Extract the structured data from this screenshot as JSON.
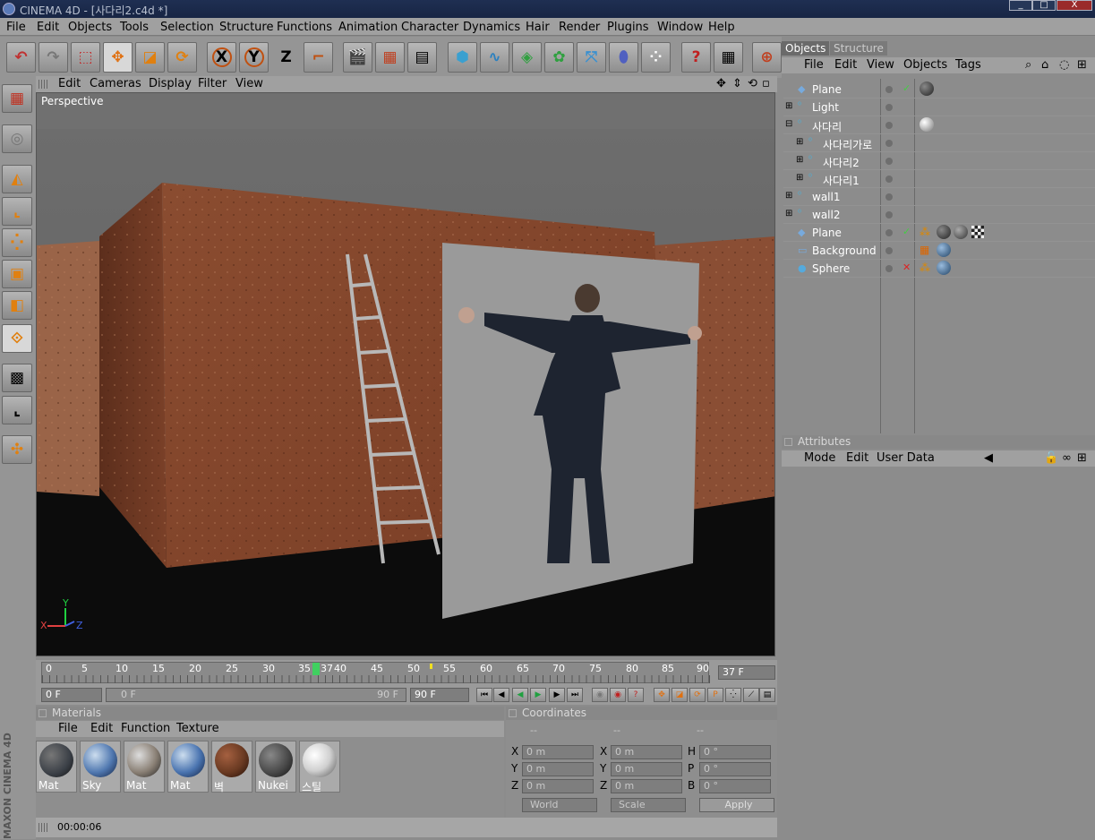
{
  "window": {
    "title": "CINEMA 4D - [사다리2.c4d *]",
    "minimize_label": "_",
    "maximize_label": "□",
    "close_label": "X"
  },
  "menu": [
    "File",
    "Edit",
    "Objects",
    "Tools",
    "Selection",
    "Structure",
    "Functions",
    "Animation",
    "Character",
    "Dynamics",
    "Hair",
    "Render",
    "Plugins",
    "Window",
    "Help"
  ],
  "toolbar": {
    "undo_icon": "undo-icon",
    "x_label": "X",
    "y_label": "Y",
    "z_label": "Z"
  },
  "viewport": {
    "menu": [
      "Edit",
      "Cameras",
      "Display",
      "Filter",
      "View"
    ],
    "label": "Perspective",
    "axis_y": "Y",
    "axis_x": "X",
    "axis_z": "Z"
  },
  "timeline": {
    "ticks": [
      "0",
      "5",
      "10",
      "15",
      "20",
      "25",
      "30",
      "35",
      "40",
      "45",
      "50",
      "55",
      "60",
      "65",
      "70",
      "75",
      "80",
      "85",
      "90"
    ],
    "current_marker": "37",
    "current_frame": "37 F",
    "start": "0 F",
    "range_start": "0 F",
    "range_end": "90 F",
    "end": "90 F"
  },
  "materials": {
    "title": "Materials",
    "menu": [
      "File",
      "Edit",
      "Function",
      "Texture"
    ],
    "items": [
      {
        "label": "Mat",
        "color": "#3a3f46"
      },
      {
        "label": "Sky",
        "color": "#5078b0"
      },
      {
        "label": "Mat",
        "color": "#8a8075"
      },
      {
        "label": "Mat",
        "color": "#4a74b0"
      },
      {
        "label": "벽",
        "color": "#6a3a22"
      },
      {
        "label": "Nukei",
        "color": "#4a4a4a"
      },
      {
        "label": "스틸",
        "color": "#d0d0d0"
      }
    ]
  },
  "coordinates": {
    "title": "Coordinates",
    "col_headers": [
      "--",
      "--",
      "--"
    ],
    "rows": [
      {
        "a": "X",
        "av": "0 m",
        "b": "X",
        "bv": "0 m",
        "c": "H",
        "cv": "0 °"
      },
      {
        "a": "Y",
        "av": "0 m",
        "b": "Y",
        "bv": "0 m",
        "c": "P",
        "cv": "0 °"
      },
      {
        "a": "Z",
        "av": "0 m",
        "b": "Z",
        "bv": "0 m",
        "c": "B",
        "cv": "0 °"
      }
    ],
    "mode1": "World",
    "mode2": "Scale",
    "apply": "Apply"
  },
  "status": {
    "time": "00:00:06",
    "brand": "MAXON CINEMA 4D"
  },
  "objects": {
    "tabs": [
      "Objects",
      "Structure"
    ],
    "menu": [
      "File",
      "Edit",
      "View",
      "Objects",
      "Tags"
    ],
    "items": [
      {
        "name": "Plane",
        "indent": 0,
        "expand": false
      },
      {
        "name": "Light",
        "indent": 0,
        "expand": true
      },
      {
        "name": "사다리",
        "indent": 0,
        "expand": true
      },
      {
        "name": "사다리가로",
        "indent": 1,
        "expand": true
      },
      {
        "name": "사다리2",
        "indent": 1,
        "expand": true
      },
      {
        "name": "사다리1",
        "indent": 1,
        "expand": true
      },
      {
        "name": "wall1",
        "indent": 0,
        "expand": true
      },
      {
        "name": "wall2",
        "indent": 0,
        "expand": true
      },
      {
        "name": "Plane",
        "indent": 0,
        "expand": false
      },
      {
        "name": "Background",
        "indent": 0,
        "expand": false
      },
      {
        "name": "Sphere",
        "indent": 0,
        "expand": false
      }
    ]
  },
  "attributes": {
    "title": "Attributes",
    "menu": [
      "Mode",
      "Edit",
      "User Data"
    ]
  }
}
